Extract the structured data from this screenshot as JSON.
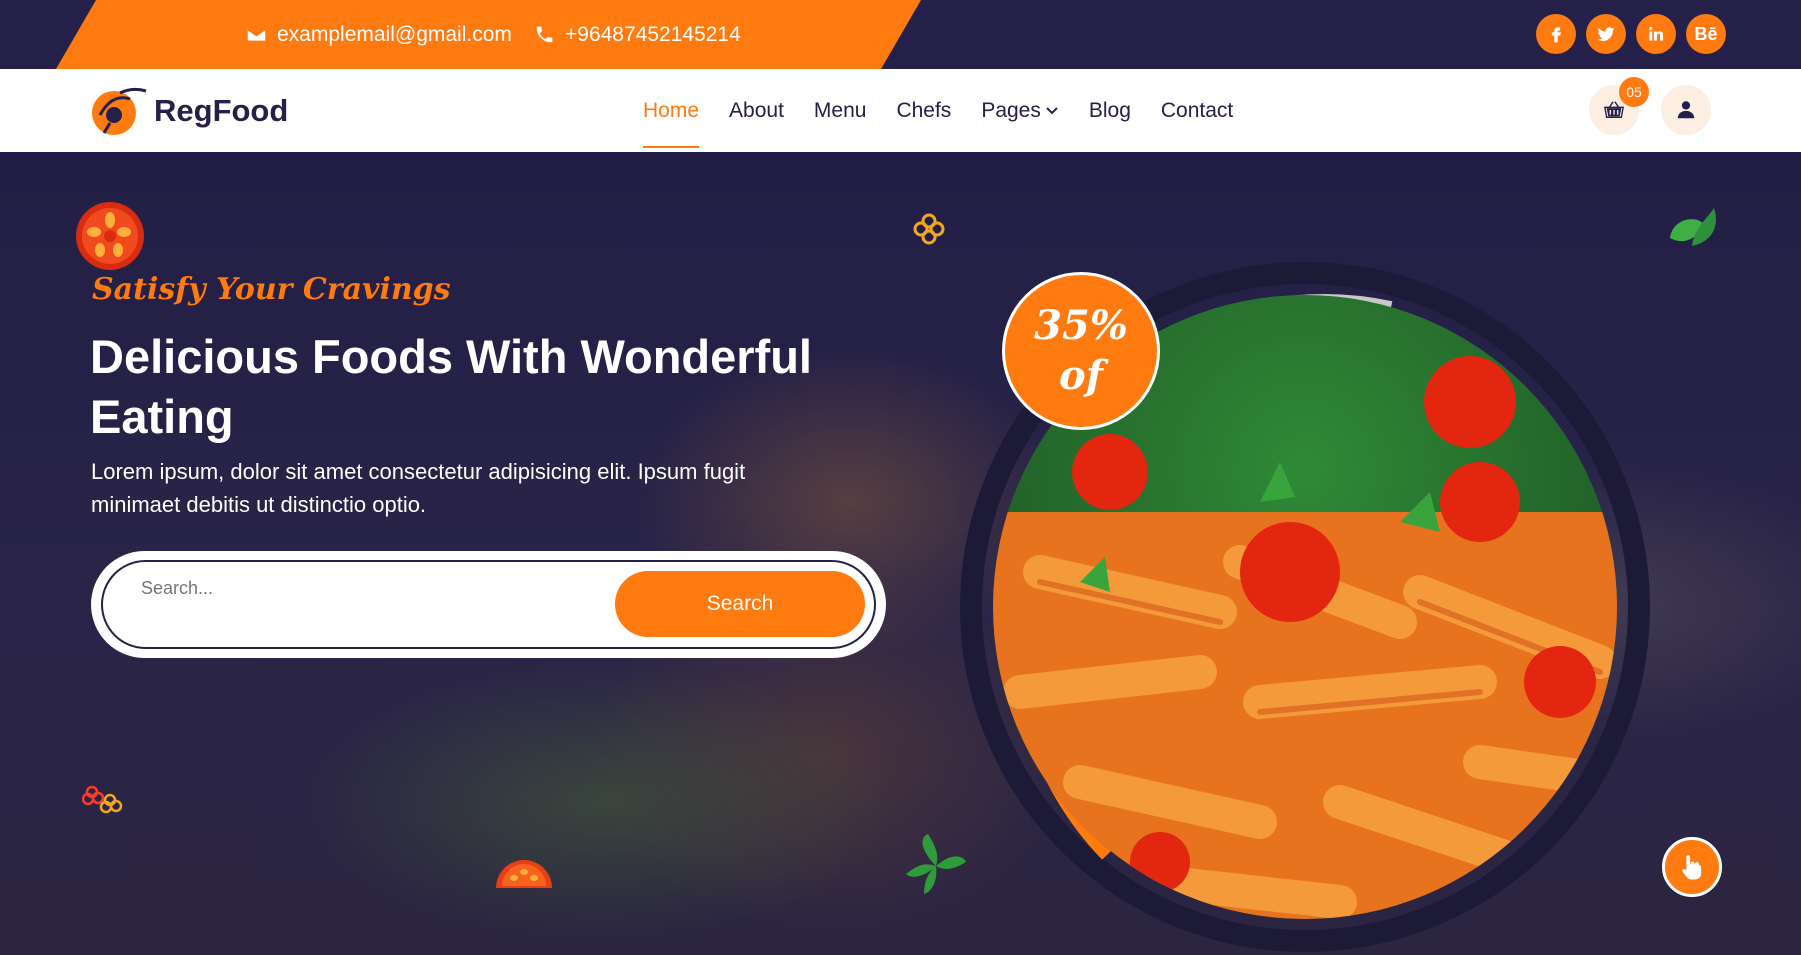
{
  "topbar": {
    "email": "examplemail@gmail.com",
    "phone": "+96487452145214",
    "socials": [
      "f",
      "t",
      "in",
      "Bē"
    ]
  },
  "header": {
    "brand": "RegFood",
    "nav": [
      {
        "label": "Home",
        "active": true
      },
      {
        "label": "About"
      },
      {
        "label": "Menu"
      },
      {
        "label": "Chefs"
      },
      {
        "label": "Pages"
      },
      {
        "label": "Blog"
      },
      {
        "label": "Contact"
      }
    ],
    "cart_count": "05"
  },
  "hero": {
    "subtitle": "Satisfy Your Cravings",
    "title": "Delicious Foods With Wonderful Eating",
    "description": "Lorem ipsum, dolor sit amet consectetur adipisicing elit. Ipsum fugit minimaet debitis ut distinctio optio.",
    "search_placeholder": "Search...",
    "search_button": "Search",
    "discount_value": "35%",
    "discount_suffix": "of"
  },
  "colors": {
    "accent": "#ff7a0f",
    "dark": "#24204a",
    "white": "#ffffff"
  }
}
